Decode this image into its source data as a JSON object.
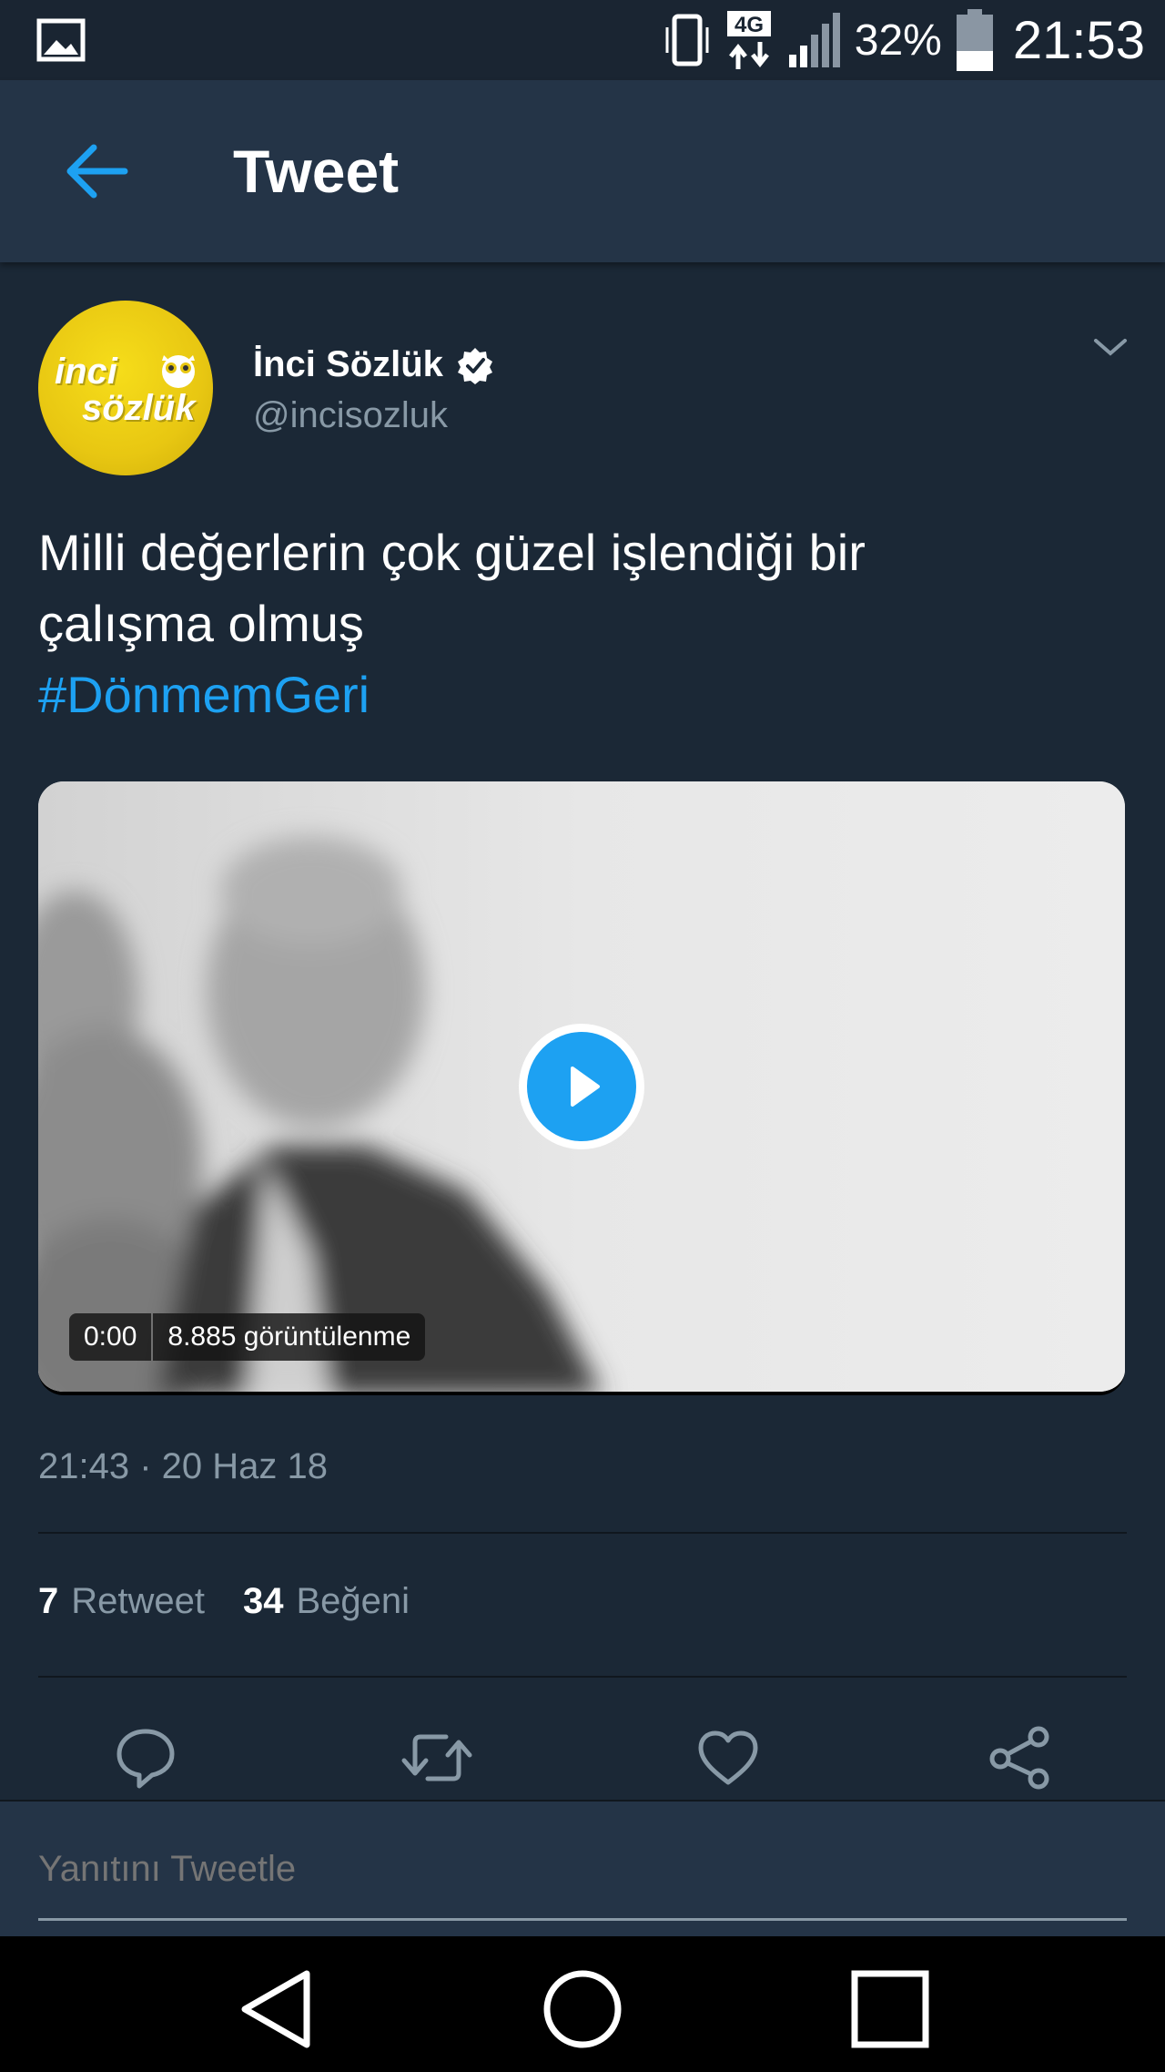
{
  "status_bar": {
    "network": "4G",
    "battery": "32%",
    "time": "21:53",
    "icons": [
      "gallery-icon",
      "vibrate-icon",
      "4g-data-icon",
      "signal-icon",
      "battery-icon"
    ]
  },
  "header": {
    "title": "Tweet",
    "back_icon": "arrow-left-icon"
  },
  "tweet": {
    "author": {
      "display_name": "İnci Sözlük",
      "handle": "@incisozluk",
      "verified": true,
      "avatar_text_line1": "inci",
      "avatar_text_line2": "sözlük",
      "avatar_color": "#f2d416"
    },
    "text_line1": "Milli değerlerin çok güzel işlendiği bir",
    "text_line2": "çalışma olmuş",
    "hashtag": "#DönmemGeri",
    "video": {
      "duration": "0:00",
      "views": "8.885 görüntülenme"
    },
    "timestamp": "21:43 · 20 Haz 18",
    "stats": {
      "retweet_count": "7",
      "retweet_label": "Retweet",
      "like_count": "34",
      "like_label": "Beğeni"
    },
    "actions": [
      "reply-icon",
      "retweet-icon",
      "like-icon",
      "share-icon"
    ]
  },
  "reply": {
    "placeholder": "Yanıtını Tweetle"
  },
  "nav": [
    "back-triangle-icon",
    "home-circle-icon",
    "recents-square-icon"
  ],
  "colors": {
    "background": "#1b2836",
    "app_bar": "#243447",
    "accent": "#1da1f2",
    "secondary_text": "#8899a6"
  }
}
